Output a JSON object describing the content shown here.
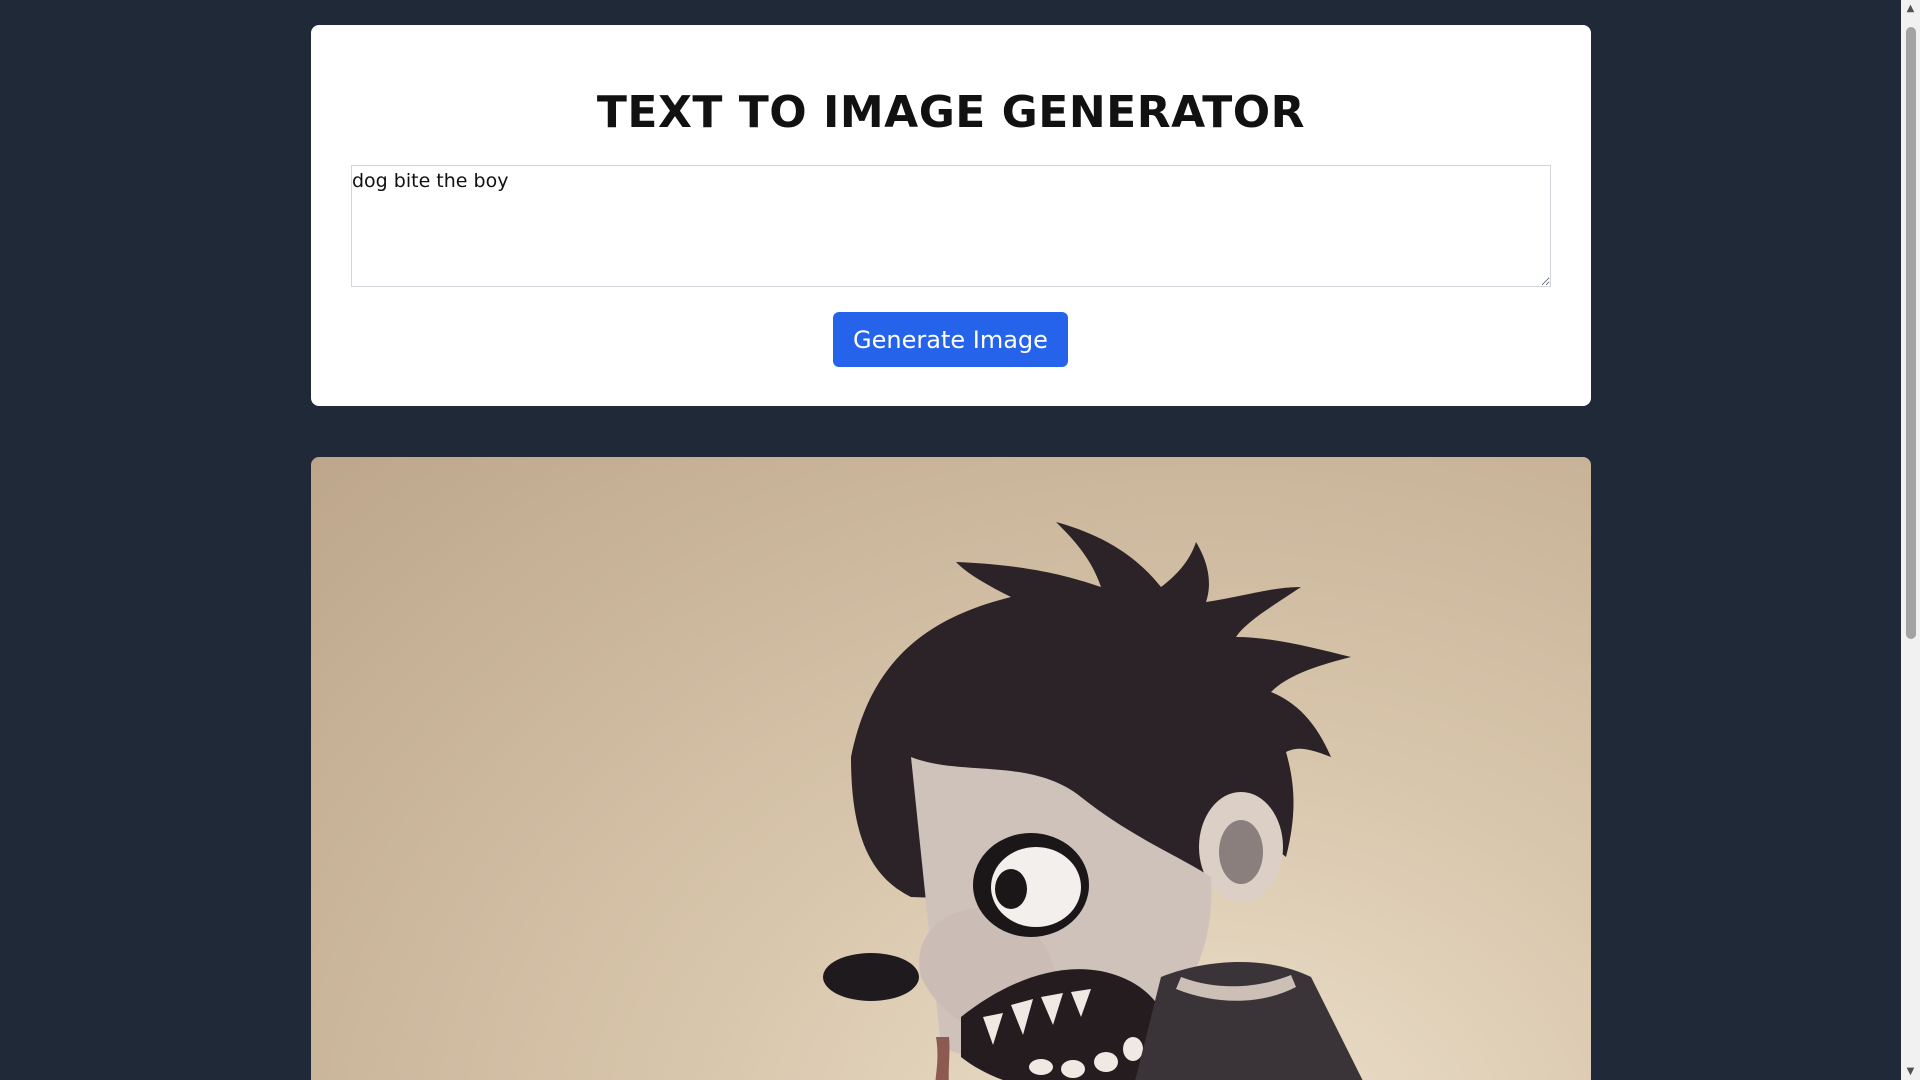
{
  "app": {
    "title": "TEXT TO IMAGE GENERATOR"
  },
  "form": {
    "prompt_value": "dog bite the boy",
    "generate_label": "Generate Image"
  },
  "output": {
    "image_subject": "generated-image"
  },
  "colors": {
    "page_bg": "#1f2937",
    "card_bg": "#ffffff",
    "button_bg": "#2563eb",
    "button_text": "#ffffff"
  },
  "icons": {
    "scroll_up": "scroll-up-arrow-icon",
    "scroll_down": "scroll-down-arrow-icon",
    "resize": "resize-handle-icon"
  }
}
